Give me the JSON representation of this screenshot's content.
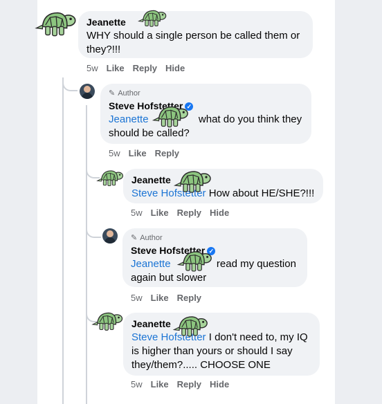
{
  "comments": [
    {
      "name": "Jeanette",
      "text": "WHY should a single person be called them or they?!!!",
      "time": "5w",
      "like": "Like",
      "reply": "Reply",
      "hide": "Hide"
    },
    {
      "author_label": "Author",
      "name": "Steve Hofstetter",
      "mention": "Jeanette",
      "text": "what do you think they should be called?",
      "time": "5w",
      "like": "Like",
      "reply": "Reply"
    },
    {
      "name": "Jeanette",
      "mention": "Steve Hofstetter",
      "text": "How about HE/SHE?!!!",
      "time": "5w",
      "like": "Like",
      "reply": "Reply",
      "hide": "Hide"
    },
    {
      "author_label": "Author",
      "name": "Steve Hofstetter",
      "mention": "Jeanette",
      "text": "read my question again but slower",
      "time": "5w",
      "like": "Like",
      "reply": "Reply"
    },
    {
      "name": "Jeanette",
      "mention": "Steve Hofstetter",
      "text": "I don't need to, my IQ is higher than yours or should I say they/them?..... CHOOSE ONE",
      "time": "5w",
      "like": "Like",
      "reply": "Reply",
      "hide": "Hide"
    }
  ],
  "icons": {
    "turtle": "turtle-sticker-icon",
    "pencil": "pencil-icon",
    "verified": "verified-badge-icon"
  },
  "colors": {
    "mention": "#1b74d4",
    "bubble": "#f0f2f5",
    "meta": "#65676b"
  }
}
